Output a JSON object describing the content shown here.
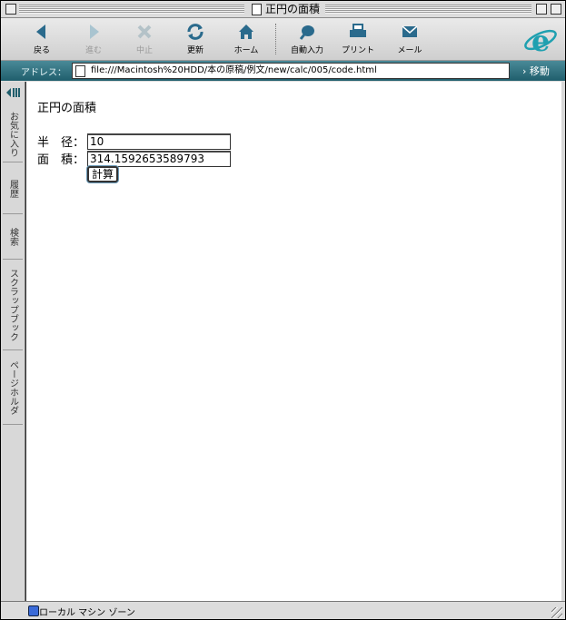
{
  "window": {
    "title": "正円の面積"
  },
  "toolbar": {
    "buttons": [
      {
        "label": "戻る",
        "icon": "back-arrow-icon",
        "enabled": true
      },
      {
        "label": "進む",
        "icon": "forward-arrow-icon",
        "enabled": false
      },
      {
        "label": "中止",
        "icon": "stop-x-icon",
        "enabled": false
      },
      {
        "label": "更新",
        "icon": "refresh-icon",
        "enabled": true
      },
      {
        "label": "ホーム",
        "icon": "home-icon",
        "enabled": true
      },
      {
        "label": "自動入力",
        "icon": "autofill-icon",
        "enabled": true
      },
      {
        "label": "プリント",
        "icon": "printer-icon",
        "enabled": true
      },
      {
        "label": "メール",
        "icon": "mail-icon",
        "enabled": true
      }
    ]
  },
  "address": {
    "label": "アドレス：",
    "url": "file:///Macintosh%20HDD/本の原稿/例文/new/calc/005/code.html",
    "go_label": "移動"
  },
  "sidebar": {
    "tabs": [
      "お気に入り",
      "履歴",
      "検索",
      "スクラップブック",
      "ページホルダ"
    ]
  },
  "page": {
    "title": "正円の面積",
    "radius_label": "半　径：",
    "radius_value": "10",
    "area_label": "面　積：",
    "area_value": "314.1592653589793",
    "calc_button": "計算"
  },
  "status": {
    "zone": "ローカル マシン ゾーン"
  },
  "colors": {
    "addressbar": "#2e7482",
    "ie_logo": "#1fa0b0",
    "nav_icons": "#2a6a8c"
  }
}
